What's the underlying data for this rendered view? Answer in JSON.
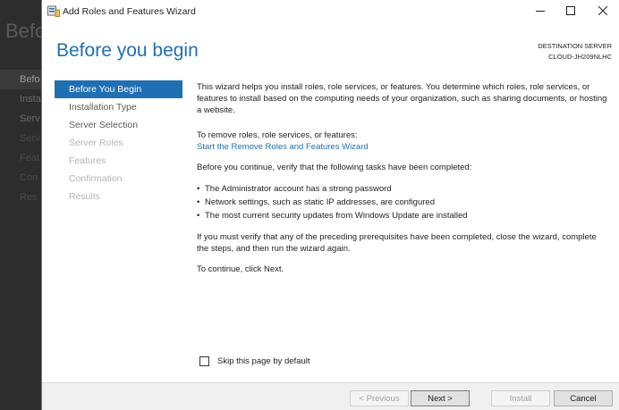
{
  "background_window": {
    "title": "Befo",
    "nav_items": [
      "Befo",
      "Insta",
      "Serv",
      "Serv",
      "Feat",
      "Con",
      "Res"
    ]
  },
  "window": {
    "title": "Add Roles and Features Wizard",
    "icon": "server-manager-icon",
    "controls": {
      "minimize": "—",
      "maximize": "☐",
      "close": "✕"
    }
  },
  "header": {
    "title": "Before you begin",
    "destination_label": "DESTINATION SERVER",
    "destination_server": "CLOUD-JH209NLHC"
  },
  "nav": {
    "items": [
      {
        "label": "Before You Begin",
        "state": "active"
      },
      {
        "label": "Installation Type",
        "state": "enabled"
      },
      {
        "label": "Server Selection",
        "state": "enabled"
      },
      {
        "label": "Server Roles",
        "state": "disabled"
      },
      {
        "label": "Features",
        "state": "disabled"
      },
      {
        "label": "Confirmation",
        "state": "disabled"
      },
      {
        "label": "Results",
        "state": "disabled"
      }
    ]
  },
  "content": {
    "intro": "This wizard helps you install roles, role services, or features. You determine which roles, role services, or features to install based on the computing needs of your organization, such as sharing documents, or hosting a website.",
    "remove_label": "To remove roles, role services, or features:",
    "remove_link": "Start the Remove Roles and Features Wizard",
    "before_continue": "Before you continue, verify that the following tasks have been completed:",
    "tasks": [
      "The Administrator account has a strong password",
      "Network settings, such as static IP addresses, are configured",
      "The most current security updates from Windows Update are installed"
    ],
    "verify": "If you must verify that any of the preceding prerequisites have been completed, close the wizard, complete the steps, and then run the wizard again.",
    "continue": "To continue, click Next."
  },
  "skip": {
    "label": "Skip this page by default",
    "checked": false
  },
  "footer": {
    "previous": "< Previous",
    "next": "Next >",
    "install": "Install",
    "cancel": "Cancel"
  }
}
